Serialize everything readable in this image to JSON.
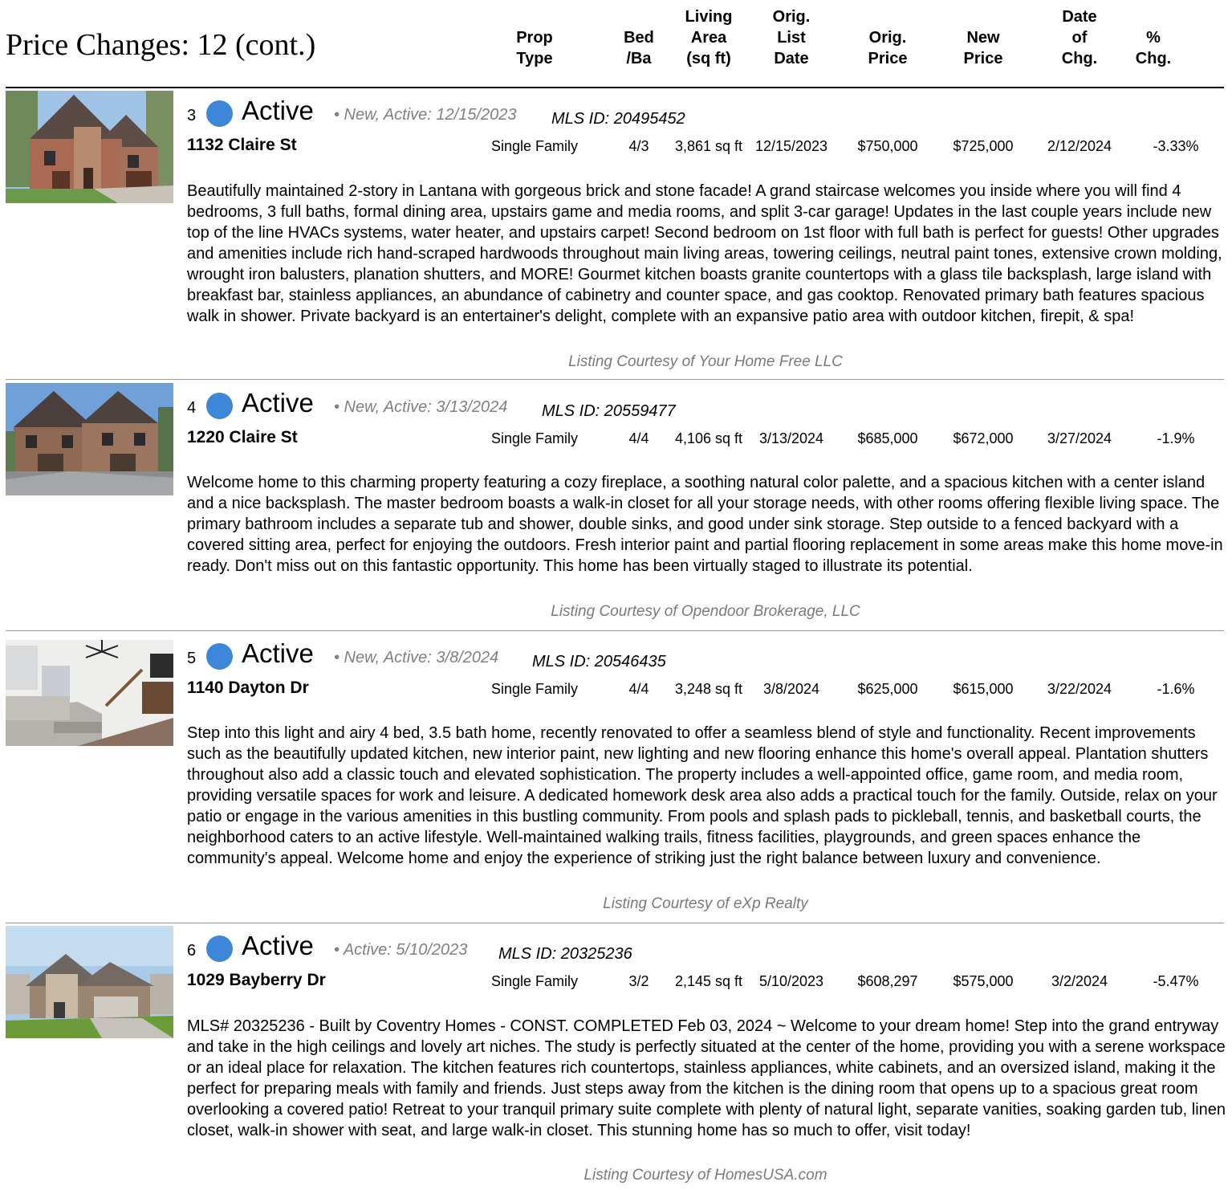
{
  "page": {
    "title": "Price Changes: 12 (cont.)"
  },
  "columns": [
    {
      "label": "Prop Type"
    },
    {
      "label": "Bed /Ba"
    },
    {
      "label": "Living Area (sq ft)"
    },
    {
      "label": "Orig. List Date"
    },
    {
      "label": "Orig. Price"
    },
    {
      "label": "New Price"
    },
    {
      "label": "Date of Chg."
    },
    {
      "label": "% Chg."
    }
  ],
  "column_lines": [
    [
      "Prop",
      "Type"
    ],
    [
      "Bed",
      "/Ba"
    ],
    [
      "Living",
      "Area",
      "(sq ft)"
    ],
    [
      "Orig.",
      "List",
      "Date"
    ],
    [
      "Orig.",
      "Price"
    ],
    [
      "New",
      "Price"
    ],
    [
      "Date",
      "of",
      "Chg."
    ],
    [
      "%",
      "Chg."
    ]
  ],
  "listings": [
    {
      "index": "3",
      "status": "Active",
      "status_color": "#3d87d8",
      "new_note": "• New, Active: 12/15/2023",
      "mls_id": "MLS ID: 20495452",
      "address": "1132 Claire St",
      "prop_type": "Single Family",
      "bed_bath": "4/3",
      "living_area": "3,861 sq ft",
      "orig_list_date": "12/15/2023",
      "orig_price": "$750,000",
      "new_price": "$725,000",
      "date_of_change": "2/12/2024",
      "pct_change": "-3.33%",
      "photo_icon": "house-exterior-photo",
      "description": "Beautifully maintained 2-story in Lantana with gorgeous brick and stone facade! A grand staircase welcomes you inside where you will find 4 bedrooms, 3 full baths, formal dining area, upstairs game and media rooms, and split 3-car garage! Updates in the last couple years include new top of the line HVACs systems, water heater, and upstairs carpet! Second bedroom on 1st floor with full bath is perfect for guests! Other upgrades and amenities include rich hand-scraped hardwoods throughout main living areas, towering ceilings, neutral paint tones, extensive crown molding, wrought iron balusters, planation shutters, and MORE! Gourmet kitchen boasts granite countertops with a glass tile backsplash, large island with breakfast bar, stainless appliances, an abundance of cabinetry and counter space, and gas cooktop. Renovated primary bath features spacious walk in shower. Private backyard is an entertainer's delight, complete with an expansive patio area with outdoor kitchen, firepit, & spa!",
      "courtesy": "Listing Courtesy of Your Home Free LLC"
    },
    {
      "index": "4",
      "status": "Active",
      "status_color": "#3d87d8",
      "new_note": "• New, Active: 3/13/2024",
      "mls_id": "MLS ID: 20559477",
      "address": "1220 Claire St",
      "prop_type": "Single Family",
      "bed_bath": "4/4",
      "living_area": "4,106 sq ft",
      "orig_list_date": "3/13/2024",
      "orig_price": "$685,000",
      "new_price": "$672,000",
      "date_of_change": "3/27/2024",
      "pct_change": "-1.9%",
      "photo_icon": "house-exterior-photo",
      "description": "Welcome home to this charming property featuring a cozy fireplace, a soothing natural color palette, and a spacious kitchen with a center island and a nice backsplash. The master bedroom boasts a walk-in closet for all your storage needs, with other rooms offering flexible living space. The primary bathroom includes a separate tub and shower, double sinks, and good under sink storage. Step outside to a fenced backyard with a covered sitting area, perfect for enjoying the outdoors. Fresh interior paint and partial flooring replacement in some areas make this home move-in ready. Don't miss out on this fantastic opportunity. This home has been virtually staged to illustrate its potential.",
      "courtesy": "Listing Courtesy of Opendoor Brokerage, LLC"
    },
    {
      "index": "5",
      "status": "Active",
      "status_color": "#3d87d8",
      "new_note": "• New, Active: 3/8/2024",
      "mls_id": "MLS ID: 20546435",
      "address": "1140 Dayton Dr",
      "prop_type": "Single Family",
      "bed_bath": "4/4",
      "living_area": "3,248 sq ft",
      "orig_list_date": "3/8/2024",
      "orig_price": "$625,000",
      "new_price": "$615,000",
      "date_of_change": "3/22/2024",
      "pct_change": "-1.6%",
      "photo_icon": "living-room-interior-photo",
      "description": "Step into this light and airy 4 bed, 3.5 bath home, recently renovated to offer a seamless blend of style and functionality. Recent improvements such as the beautifully updated kitchen, new interior paint, new lighting and new flooring enhance this home's overall appeal. Plantation shutters throughout also add a classic touch and elevated sophistication. The property includes a well-appointed office, game room, and media room, providing versatile spaces for work and leisure. A dedicated homework desk area also adds a practical touch for the family. Outside, relax on your patio or engage in the various amenities in this bustling community. From pools and splash pads to pickleball, tennis, and basketball courts, the neighborhood caters to an active lifestyle. Well-maintained walking trails, fitness facilities, playgrounds, and green spaces enhance the community's appeal. Welcome home and enjoy the experience of striking just the right balance between luxury and convenience.",
      "courtesy": "Listing Courtesy of eXp Realty"
    },
    {
      "index": "6",
      "status": "Active",
      "status_color": "#3d87d8",
      "new_note": "• Active: 5/10/2023",
      "mls_id": "MLS ID: 20325236",
      "address": "1029 Bayberry Dr",
      "prop_type": "Single Family",
      "bed_bath": "3/2",
      "living_area": "2,145 sq ft",
      "orig_list_date": "5/10/2023",
      "orig_price": "$608,297",
      "new_price": "$575,000",
      "date_of_change": "3/2/2024",
      "pct_change": "-5.47%",
      "photo_icon": "house-exterior-photo",
      "description": "MLS# 20325236 - Built by Coventry Homes - CONST. COMPLETED Feb 03, 2024 ~ Welcome to your dream home! Step into the grand entryway and take in the high ceilings and lovely art niches. The study is perfectly situated at the center of the home, providing you with a serene workspace or an ideal place for relaxation. The kitchen features rich countertops, stainless appliances, white cabinets, and an oversized island, making it the perfect for preparing meals with family and friends. Just steps away from the kitchen is the dining room that opens up to a spacious great room overlooking a covered patio! Retreat to your tranquil primary suite complete with plenty of natural light, separate vanities, soaking garden tub, linen closet, walk-in shower with seat, and large walk-in closet. This stunning home has so much to offer, visit today!",
      "courtesy": "Listing Courtesy of HomesUSA.com"
    }
  ]
}
